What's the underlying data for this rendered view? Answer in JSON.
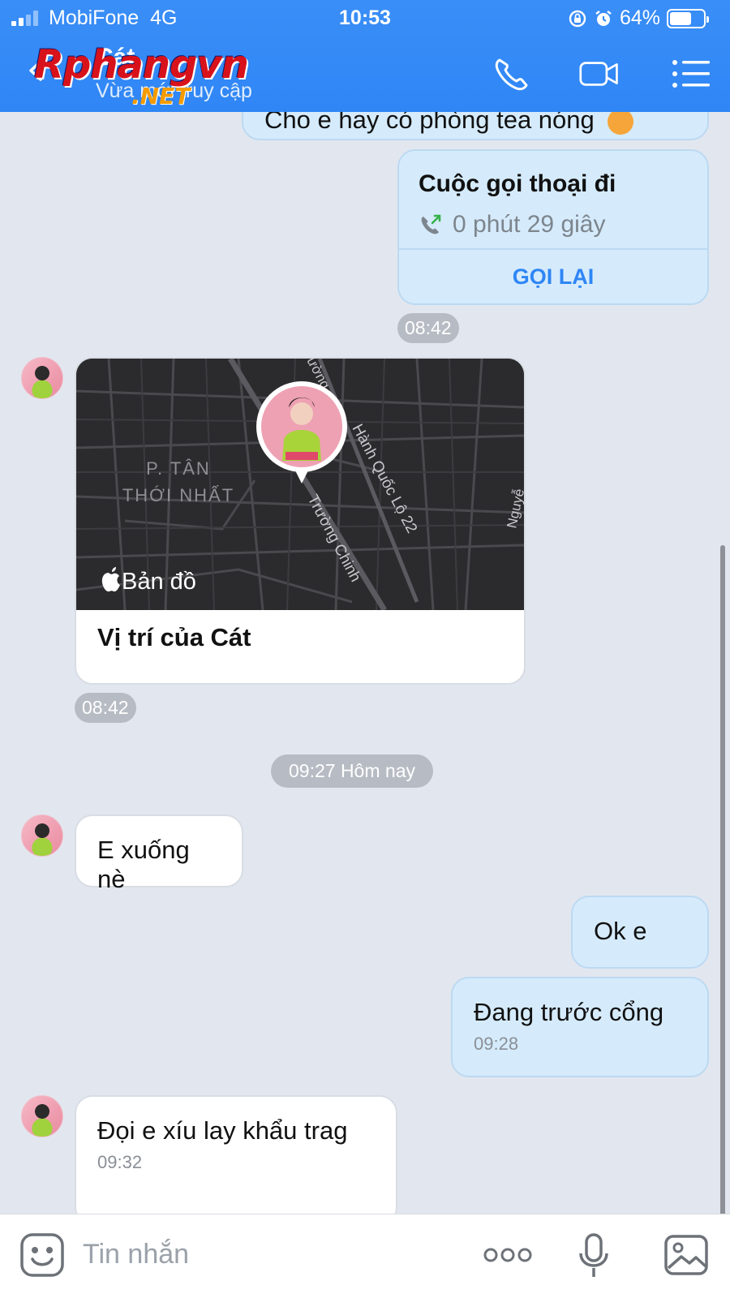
{
  "status_bar": {
    "carrier": "MobiFone",
    "network": "4G",
    "time": "10:53",
    "battery": "64%",
    "battery_level": 0.64
  },
  "header": {
    "contact_name": "Cát",
    "contact_status": "Vừa mới truy cập",
    "watermark_brand": "Rphangvn",
    "watermark_tld": ".NET",
    "icons": [
      "back-icon",
      "phone-icon",
      "video-call-icon",
      "menu-icon"
    ]
  },
  "messages": {
    "partial_top_text": "Cho e hay có phòng tea nóng",
    "call": {
      "title": "Cuộc gọi thoại đi",
      "duration": "0 phút 29 giây",
      "action": "GỌI LẠI"
    },
    "call_time": "08:42",
    "location": {
      "map_labels": {
        "district_line1": "P. TÂN",
        "district_line2": "THỚI NHẤT",
        "street1": "Trường Chinh",
        "street2": "Hành Quốc Lộ 22",
        "street3": "Nguyễ",
        "street4": "ường"
      },
      "map_brand": "Bản đồ",
      "title": "Vị trí của Cát",
      "time": "08:42"
    },
    "day_separator": "09:27 Hôm nay",
    "m1": {
      "text": "E xuống nè"
    },
    "m2": {
      "text": "Ok e"
    },
    "m3": {
      "text": "Đang trước cổng",
      "time": "09:28"
    },
    "m4": {
      "text": "Đọi e xíu lay khẩu trag",
      "time": "09:32"
    }
  },
  "input": {
    "placeholder": "Tin nhắn",
    "icons": [
      "sticker-icon",
      "more-icon",
      "microphone-icon",
      "image-icon"
    ]
  },
  "colors": {
    "header_blue": "#2f86f5",
    "sent_bubble": "#d5ebfc",
    "received_bubble": "#ffffff",
    "background": "#e2e7ef"
  }
}
